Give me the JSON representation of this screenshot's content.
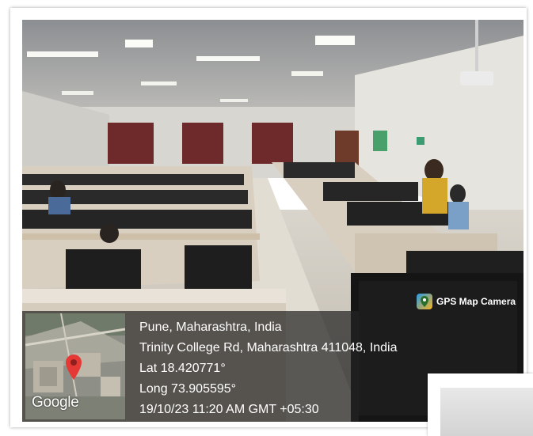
{
  "overlay": {
    "app_badge": "GPS Map Camera",
    "map_provider": "Google",
    "location_line": "Pune, Maharashtra, India",
    "address_line": "Trinity College Rd, Maharashtra 411048, India",
    "lat_line": "Lat 18.420771°",
    "long_line": "Long 73.905595°",
    "datetime_line": "19/10/23 11:20 AM GMT +05:30",
    "pin_color": "#e53935"
  },
  "icons": [
    "map-pin-icon",
    "gps-camera-icon"
  ]
}
